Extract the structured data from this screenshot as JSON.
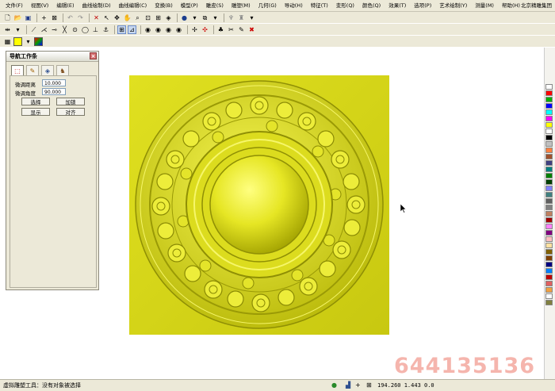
{
  "menu": [
    "文件(F)",
    "视图(V)",
    "编辑(E)",
    "曲线绘制(D)",
    "曲线编辑(C)",
    "变换(B)",
    "模型(P)",
    "雕皮(S)",
    "雕塑(M)",
    "几何(G)",
    "导动(H)",
    "特征(T)",
    "变形(Q)",
    "颜色(Q)",
    "效果(T)",
    "选项(P)",
    "艺术绘制(Y)",
    "测量(M)",
    "帮助(H)"
  ],
  "company": "北京精雕集团",
  "nav": {
    "title": "导航工作条",
    "close_glyph": "×",
    "field1_label": "微调距离",
    "field1_value": "10.000",
    "field2_label": "微调角度",
    "field2_value": "90.000",
    "btn_select": "选择",
    "btn_lock": "加锁",
    "btn_show": "显示",
    "btn_align": "对齐"
  },
  "status": {
    "text": "虚拟雕塑工具：没有对象被选择",
    "coords": "194.260 1.443 0.0"
  },
  "watermark": "644135136",
  "palette": [
    "#ffffff",
    "#ff0000",
    "#00b000",
    "#0000ff",
    "#00ffff",
    "#ff00ff",
    "#ffff00",
    "#ffffff",
    "#000000",
    "#c0c0c0",
    "#ff8040",
    "#a0522d",
    "#404080",
    "#008080",
    "#008000",
    "#004000",
    "#8080ff",
    "#408080",
    "#606060",
    "#808080",
    "#c08060",
    "#a00000",
    "#ff80ff",
    "#800080",
    "#ffc0c0",
    "#ffe0a0",
    "#806000",
    "#804000",
    "#000080",
    "#0080ff",
    "#c00000",
    "#e06060",
    "#f0a040",
    "#ffffff",
    "#808040"
  ],
  "colors": {
    "carving_light": "#f2f24a",
    "carving_mid": "#d8d81a",
    "carving_dark": "#8f8f05"
  }
}
